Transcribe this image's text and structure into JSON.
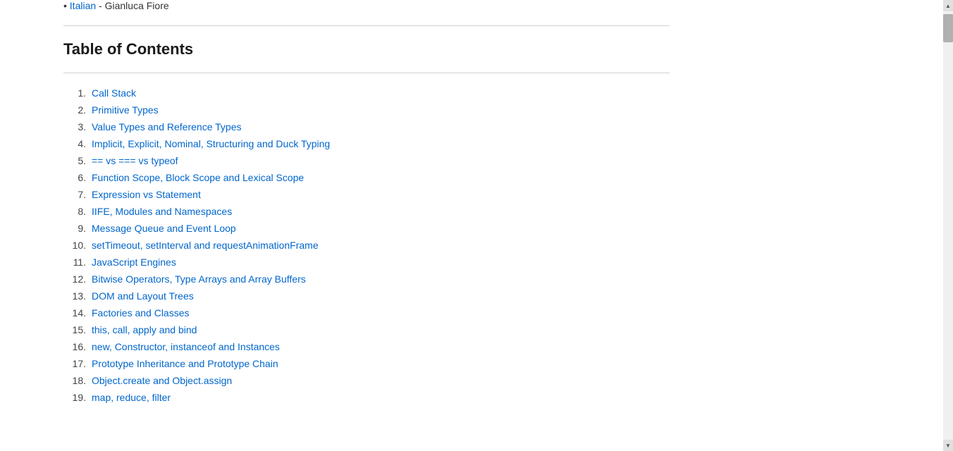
{
  "header": {
    "breadcrumb_text": "Italian",
    "breadcrumb_author": " - Gianluca Fiore"
  },
  "toc": {
    "title": "Table of Contents",
    "items": [
      {
        "num": "1.",
        "label": "Call Stack"
      },
      {
        "num": "2.",
        "label": "Primitive Types"
      },
      {
        "num": "3.",
        "label": "Value Types and Reference Types"
      },
      {
        "num": "4.",
        "label": "Implicit, Explicit, Nominal, Structuring and Duck Typing"
      },
      {
        "num": "5.",
        "label": "== vs === vs typeof"
      },
      {
        "num": "6.",
        "label": "Function Scope, Block Scope and Lexical Scope"
      },
      {
        "num": "7.",
        "label": "Expression vs Statement"
      },
      {
        "num": "8.",
        "label": "IIFE, Modules and Namespaces"
      },
      {
        "num": "9.",
        "label": "Message Queue and Event Loop"
      },
      {
        "num": "10.",
        "label": "setTimeout, setInterval and requestAnimationFrame"
      },
      {
        "num": "11.",
        "label": "JavaScript Engines"
      },
      {
        "num": "12.",
        "label": "Bitwise Operators, Type Arrays and Array Buffers"
      },
      {
        "num": "13.",
        "label": "DOM and Layout Trees"
      },
      {
        "num": "14.",
        "label": "Factories and Classes"
      },
      {
        "num": "15.",
        "label": "this, call, apply and bind"
      },
      {
        "num": "16.",
        "label": "new, Constructor, instanceof and Instances"
      },
      {
        "num": "17.",
        "label": "Prototype Inheritance and Prototype Chain"
      },
      {
        "num": "18.",
        "label": "Object.create and Object.assign"
      },
      {
        "num": "19.",
        "label": "map, reduce, filter"
      }
    ]
  },
  "scrollbar": {
    "arrow_up": "▲",
    "arrow_down": "▼"
  }
}
